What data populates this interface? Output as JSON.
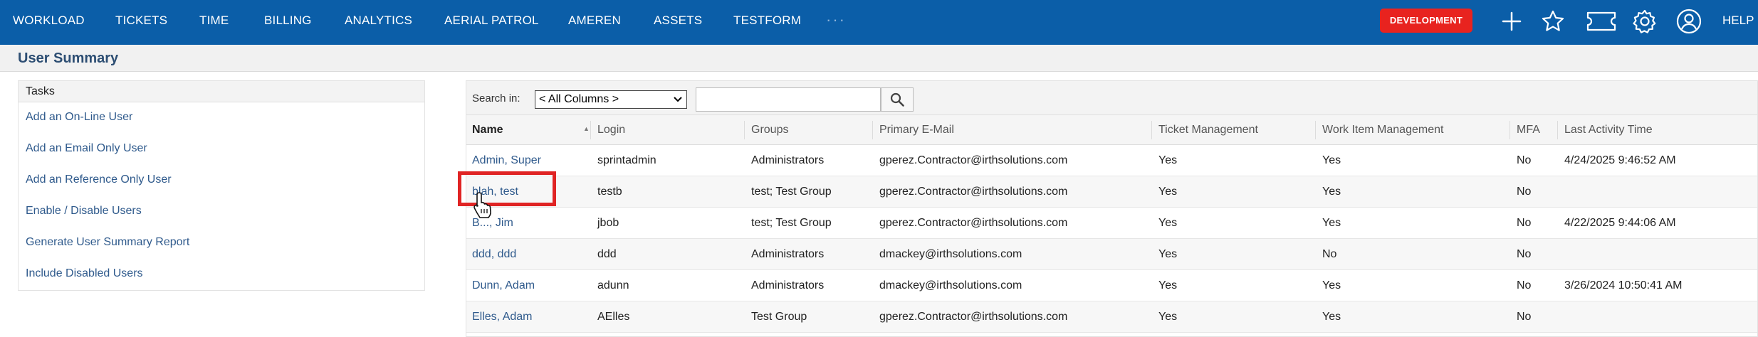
{
  "nav": {
    "items": [
      "WORKLOAD",
      "TICKETS",
      "TIME",
      "BILLING",
      "ANALYTICS",
      "AERIAL PATROL",
      "AMEREN",
      "ASSETS",
      "TESTFORM"
    ],
    "more": "···",
    "env_badge": "DEVELOPMENT",
    "help": "HELP",
    "icons": [
      "plus-icon",
      "star-icon",
      "ticket-icon",
      "gear-icon",
      "user-icon"
    ],
    "colors": {
      "bar": "#0b5ea8",
      "badge": "#e8231f"
    }
  },
  "page": {
    "title": "User Summary"
  },
  "tasks": {
    "heading": "Tasks",
    "links": [
      "Add an On-Line User",
      "Add an Email Only User",
      "Add an Reference Only User",
      "Enable / Disable Users",
      "Generate User Summary Report",
      "Include Disabled Users"
    ]
  },
  "search": {
    "label": "Search in:",
    "select_value": "< All Columns >",
    "input_value": ""
  },
  "table": {
    "columns": [
      "Name",
      "Login",
      "Groups",
      "Primary E-Mail",
      "Ticket Management",
      "Work Item Management",
      "MFA",
      "Last Activity Time"
    ],
    "rows": [
      [
        "Admin, Super",
        "sprintadmin",
        "Administrators",
        "gperez.Contractor@irthsolutions.com",
        "Yes",
        "Yes",
        "No",
        "4/24/2025 9:46:52 AM"
      ],
      [
        "blah, test",
        "testb",
        "test; Test Group",
        "gperez.Contractor@irthsolutions.com",
        "Yes",
        "Yes",
        "No",
        ""
      ],
      [
        "B..., Jim",
        "jbob",
        "test; Test Group",
        "gperez.Contractor@irthsolutions.com",
        "Yes",
        "Yes",
        "No",
        "4/22/2025 9:44:06 AM"
      ],
      [
        "ddd, ddd",
        "ddd",
        "Administrators",
        "dmackey@irthsolutions.com",
        "Yes",
        "No",
        "No",
        ""
      ],
      [
        "Dunn, Adam",
        "adunn",
        "Administrators",
        "dmackey@irthsolutions.com",
        "Yes",
        "Yes",
        "No",
        "3/26/2024 10:50:41 AM"
      ],
      [
        "Elles, Adam",
        "AElles",
        "Test Group",
        "gperez.Contractor@irthsolutions.com",
        "Yes",
        "Yes",
        "No",
        ""
      ]
    ]
  }
}
